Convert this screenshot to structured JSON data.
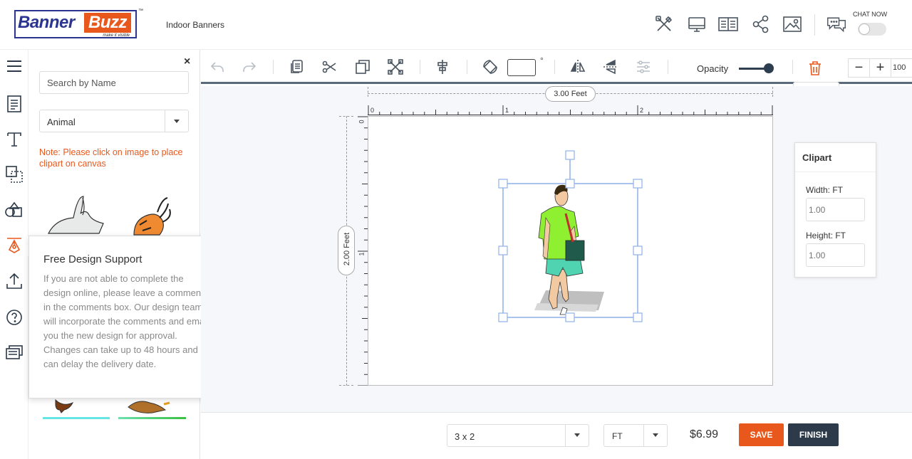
{
  "header": {
    "logo_left": "Banner",
    "logo_right": "Buzz",
    "logo_tagline": "make it visible",
    "logo_tm": "™",
    "product_title": "Indoor Banners",
    "chat_label": "CHAT NOW",
    "icons": [
      "tools-icon",
      "desktop-preview-icon",
      "book-icon",
      "share-icon",
      "image-icon",
      "chat-icon"
    ]
  },
  "left_rail": {
    "icons": [
      "hamburger-menu-icon",
      "template-icon",
      "text-icon",
      "shapes-icon",
      "clipart-icon",
      "pen-tool-icon",
      "upload-icon",
      "help-icon",
      "comments-icon"
    ]
  },
  "panel": {
    "search_placeholder": "Search by Name",
    "category": "Animal",
    "note": "Note: Please click on image to place clipart on canvas",
    "close": "×"
  },
  "support_popup": {
    "title": "Free Design Support",
    "close": "×",
    "body": "If you are not able to complete the design online, please leave a comments in the comments box. Our design team will incorporate the comments and email you the new design for approval. Changes can take up to 48 hours and can delay the delivery date."
  },
  "toolbar": {
    "degree_symbol": "°",
    "rotation_value": "",
    "opacity_label": "Opacity",
    "opacity_value": 1.0,
    "trash_tooltip": "Trash",
    "zoom_minus": "−",
    "zoom_plus": "+",
    "zoom_value": "100"
  },
  "canvas": {
    "width_label": "3.00 Feet",
    "height_label": "2.00 Feet",
    "ruler_top": [
      "0",
      "1",
      "2"
    ],
    "ruler_left": [
      "0",
      "1"
    ]
  },
  "clipart_panel": {
    "title": "Clipart",
    "width_label": "Width: FT",
    "width_placeholder": "1.00",
    "height_label": "Height: FT",
    "height_placeholder": "1.00"
  },
  "footer": {
    "size": "3 x 2",
    "unit": "FT",
    "price": "$6.99",
    "save_label": "SAVE",
    "finish_label": "FINISH"
  },
  "colors": {
    "brand_blue": "#2b3590",
    "brand_orange": "#e8581c",
    "dark": "#2d3a4a"
  }
}
